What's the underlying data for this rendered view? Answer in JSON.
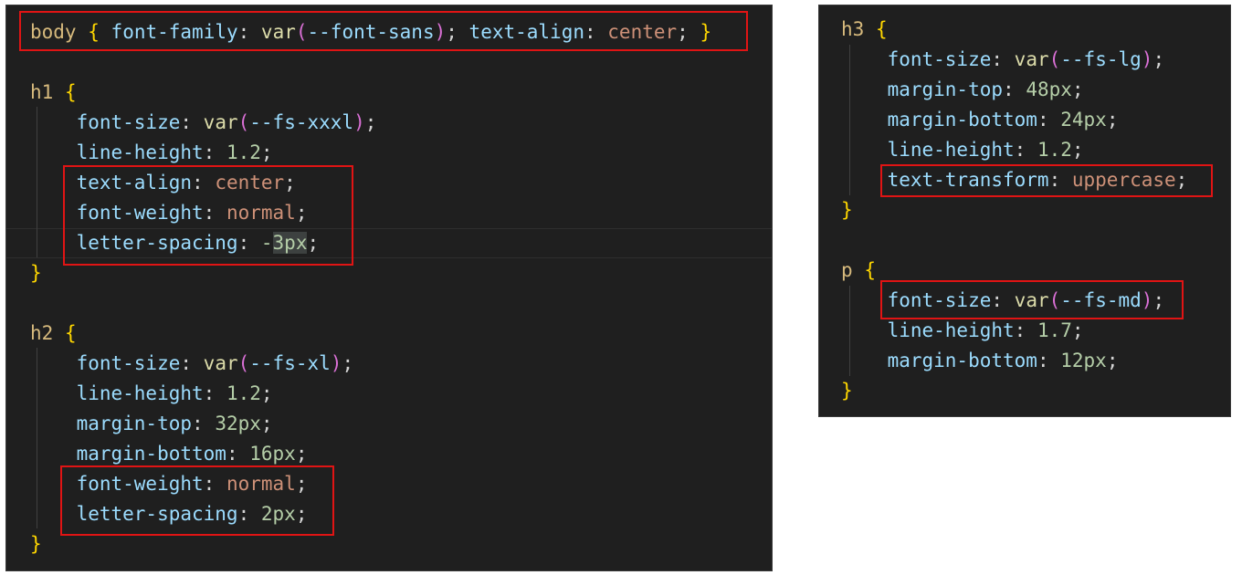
{
  "left_pane": {
    "lines": [
      {
        "parts": [
          {
            "t": "body",
            "c": "sel-c"
          },
          {
            "t": " ",
            "c": "pn"
          },
          {
            "t": "{",
            "c": "br1"
          },
          {
            "t": " ",
            "c": "pn"
          },
          {
            "t": "font-family",
            "c": "sel-p"
          },
          {
            "t": ": ",
            "c": "pn"
          },
          {
            "t": "var",
            "c": "v-f"
          },
          {
            "t": "(",
            "c": "br2"
          },
          {
            "t": "--font-sans",
            "c": "v-v"
          },
          {
            "t": ")",
            "c": "br2"
          },
          {
            "t": "; ",
            "c": "pn"
          },
          {
            "t": "text-align",
            "c": "sel-p"
          },
          {
            "t": ": ",
            "c": "pn"
          },
          {
            "t": "center",
            "c": "v-k"
          },
          {
            "t": "; ",
            "c": "pn"
          },
          {
            "t": "}",
            "c": "br1"
          }
        ]
      },
      {
        "parts": []
      },
      {
        "parts": [
          {
            "t": "h1",
            "c": "sel-c"
          },
          {
            "t": " ",
            "c": "pn"
          },
          {
            "t": "{",
            "c": "br1"
          }
        ]
      },
      {
        "parts": [
          {
            "t": "    font-size",
            "c": "sel-p"
          },
          {
            "t": ": ",
            "c": "pn"
          },
          {
            "t": "var",
            "c": "v-f"
          },
          {
            "t": "(",
            "c": "br2"
          },
          {
            "t": "--fs-xxxl",
            "c": "v-v"
          },
          {
            "t": ")",
            "c": "br2"
          },
          {
            "t": ";",
            "c": "pn"
          }
        ]
      },
      {
        "parts": [
          {
            "t": "    line-height",
            "c": "sel-p"
          },
          {
            "t": ": ",
            "c": "pn"
          },
          {
            "t": "1.2",
            "c": "v-n"
          },
          {
            "t": ";",
            "c": "pn"
          }
        ]
      },
      {
        "parts": [
          {
            "t": "    text-align",
            "c": "sel-p"
          },
          {
            "t": ": ",
            "c": "pn"
          },
          {
            "t": "center",
            "c": "v-k"
          },
          {
            "t": ";",
            "c": "pn"
          }
        ]
      },
      {
        "parts": [
          {
            "t": "    font-weight",
            "c": "sel-p"
          },
          {
            "t": ": ",
            "c": "pn"
          },
          {
            "t": "normal",
            "c": "v-k"
          },
          {
            "t": ";",
            "c": "pn"
          }
        ]
      },
      {
        "parts": [
          {
            "t": "    letter-spacing",
            "c": "sel-p"
          },
          {
            "t": ": ",
            "c": "pn"
          },
          {
            "t": "-",
            "c": "v-n"
          },
          {
            "t": "3px",
            "c": "v-n sel"
          },
          {
            "t": ";",
            "c": "pn"
          }
        ]
      },
      {
        "parts": [
          {
            "t": "}",
            "c": "br1"
          }
        ]
      },
      {
        "parts": []
      },
      {
        "parts": [
          {
            "t": "h2",
            "c": "sel-c"
          },
          {
            "t": " ",
            "c": "pn"
          },
          {
            "t": "{",
            "c": "br1"
          }
        ]
      },
      {
        "parts": [
          {
            "t": "    font-size",
            "c": "sel-p"
          },
          {
            "t": ": ",
            "c": "pn"
          },
          {
            "t": "var",
            "c": "v-f"
          },
          {
            "t": "(",
            "c": "br2"
          },
          {
            "t": "--fs-xl",
            "c": "v-v"
          },
          {
            "t": ")",
            "c": "br2"
          },
          {
            "t": ";",
            "c": "pn"
          }
        ]
      },
      {
        "parts": [
          {
            "t": "    line-height",
            "c": "sel-p"
          },
          {
            "t": ": ",
            "c": "pn"
          },
          {
            "t": "1.2",
            "c": "v-n"
          },
          {
            "t": ";",
            "c": "pn"
          }
        ]
      },
      {
        "parts": [
          {
            "t": "    margin-top",
            "c": "sel-p"
          },
          {
            "t": ": ",
            "c": "pn"
          },
          {
            "t": "32px",
            "c": "v-n"
          },
          {
            "t": ";",
            "c": "pn"
          }
        ]
      },
      {
        "parts": [
          {
            "t": "    margin-bottom",
            "c": "sel-p"
          },
          {
            "t": ": ",
            "c": "pn"
          },
          {
            "t": "16px",
            "c": "v-n"
          },
          {
            "t": ";",
            "c": "pn"
          }
        ]
      },
      {
        "parts": [
          {
            "t": "    font-weight",
            "c": "sel-p"
          },
          {
            "t": ": ",
            "c": "pn"
          },
          {
            "t": "normal",
            "c": "v-k"
          },
          {
            "t": ";",
            "c": "pn"
          }
        ]
      },
      {
        "parts": [
          {
            "t": "    letter-spacing",
            "c": "sel-p"
          },
          {
            "t": ": ",
            "c": "pn"
          },
          {
            "t": "2px",
            "c": "v-n"
          },
          {
            "t": ";",
            "c": "pn"
          }
        ]
      },
      {
        "parts": [
          {
            "t": "}",
            "c": "br1"
          }
        ]
      }
    ]
  },
  "right_pane": {
    "lines": [
      {
        "parts": [
          {
            "t": "h3",
            "c": "sel-c"
          },
          {
            "t": " ",
            "c": "pn"
          },
          {
            "t": "{",
            "c": "br1"
          }
        ]
      },
      {
        "parts": [
          {
            "t": "    font-size",
            "c": "sel-p"
          },
          {
            "t": ": ",
            "c": "pn"
          },
          {
            "t": "var",
            "c": "v-f"
          },
          {
            "t": "(",
            "c": "br2"
          },
          {
            "t": "--fs-lg",
            "c": "v-v"
          },
          {
            "t": ")",
            "c": "br2"
          },
          {
            "t": ";",
            "c": "pn"
          }
        ]
      },
      {
        "parts": [
          {
            "t": "    margin-top",
            "c": "sel-p"
          },
          {
            "t": ": ",
            "c": "pn"
          },
          {
            "t": "48px",
            "c": "v-n"
          },
          {
            "t": ";",
            "c": "pn"
          }
        ]
      },
      {
        "parts": [
          {
            "t": "    margin-bottom",
            "c": "sel-p"
          },
          {
            "t": ": ",
            "c": "pn"
          },
          {
            "t": "24px",
            "c": "v-n"
          },
          {
            "t": ";",
            "c": "pn"
          }
        ]
      },
      {
        "parts": [
          {
            "t": "    line-height",
            "c": "sel-p"
          },
          {
            "t": ": ",
            "c": "pn"
          },
          {
            "t": "1.2",
            "c": "v-n"
          },
          {
            "t": ";",
            "c": "pn"
          }
        ]
      },
      {
        "parts": [
          {
            "t": "    text-transform",
            "c": "sel-p"
          },
          {
            "t": ": ",
            "c": "pn"
          },
          {
            "t": "uppercase",
            "c": "v-k"
          },
          {
            "t": ";",
            "c": "pn"
          }
        ]
      },
      {
        "parts": [
          {
            "t": "}",
            "c": "br1"
          }
        ]
      },
      {
        "parts": []
      },
      {
        "parts": [
          {
            "t": "p",
            "c": "sel-c"
          },
          {
            "t": " ",
            "c": "pn"
          },
          {
            "t": "{",
            "c": "br1"
          }
        ]
      },
      {
        "parts": [
          {
            "t": "    font-size",
            "c": "sel-p"
          },
          {
            "t": ": ",
            "c": "pn"
          },
          {
            "t": "var",
            "c": "v-f"
          },
          {
            "t": "(",
            "c": "br2"
          },
          {
            "t": "--fs-md",
            "c": "v-v"
          },
          {
            "t": ")",
            "c": "br2"
          },
          {
            "t": ";",
            "c": "pn"
          }
        ]
      },
      {
        "parts": [
          {
            "t": "    line-height",
            "c": "sel-p"
          },
          {
            "t": ": ",
            "c": "pn"
          },
          {
            "t": "1.7",
            "c": "v-n"
          },
          {
            "t": ";",
            "c": "pn"
          }
        ]
      },
      {
        "parts": [
          {
            "t": "    margin-bottom",
            "c": "sel-p"
          },
          {
            "t": ": ",
            "c": "pn"
          },
          {
            "t": "12px",
            "c": "v-n"
          },
          {
            "t": ";",
            "c": "pn"
          }
        ]
      },
      {
        "parts": [
          {
            "t": "}",
            "c": "br1"
          }
        ]
      }
    ]
  },
  "colors": {
    "editor_bg": "#1f1f1f",
    "highlight_box": "#e01414",
    "selector": "#d7ba7d",
    "property": "#9cdcfe",
    "keyword_value": "#ce9178",
    "number_value": "#b5cea8",
    "function": "#dcdcaa",
    "bracket_outer": "#ffd700",
    "bracket_inner": "#da70d6"
  }
}
